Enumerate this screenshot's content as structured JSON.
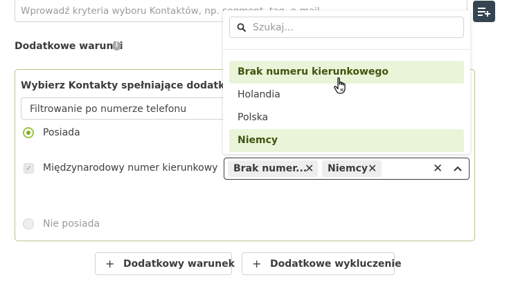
{
  "criteria": {
    "placeholder": "Wprowadź kryteria wyboru Kontaktów, np. segment, tag, e-mail"
  },
  "section": {
    "title": "Dodatkowe warunki",
    "info_icon": "i"
  },
  "panel": {
    "title": "Wybierz Kontakty spełniające dodatkowy warunek",
    "filter_value": "Filtrowanie po numerze telefonu",
    "radio_has": "Posiada",
    "checkbox_intl": "Międzynarodowy numer kierunkowy",
    "radio_not": "Nie posiada"
  },
  "tags": {
    "items": [
      {
        "label": "Brak numer...",
        "remove": "✕"
      },
      {
        "label": "Niemcy",
        "remove": "✕"
      }
    ],
    "clear": "✕"
  },
  "dropdown": {
    "search_placeholder": "Szukaj...",
    "options": [
      {
        "label": "Brak numeru kierunkowego",
        "selected": true
      },
      {
        "label": "Holandia",
        "selected": false
      },
      {
        "label": "Polska",
        "selected": false
      },
      {
        "label": "Niemcy",
        "selected": true
      }
    ]
  },
  "buttons": {
    "plus": "+",
    "add_condition": "Dodatkowy warunek",
    "add_exclusion": "Dodatkowe wykluczenie"
  },
  "icons": {
    "add_list": "playlist-add-icon",
    "search": "search-icon",
    "chevron": "chevron-up-icon",
    "cursor": "hand-pointer-icon"
  },
  "colors": {
    "accent_green": "#7fb116",
    "selected_option_bg": "#eaf4d8",
    "dark_button": "#354450",
    "panel_border": "#b7c48a"
  }
}
